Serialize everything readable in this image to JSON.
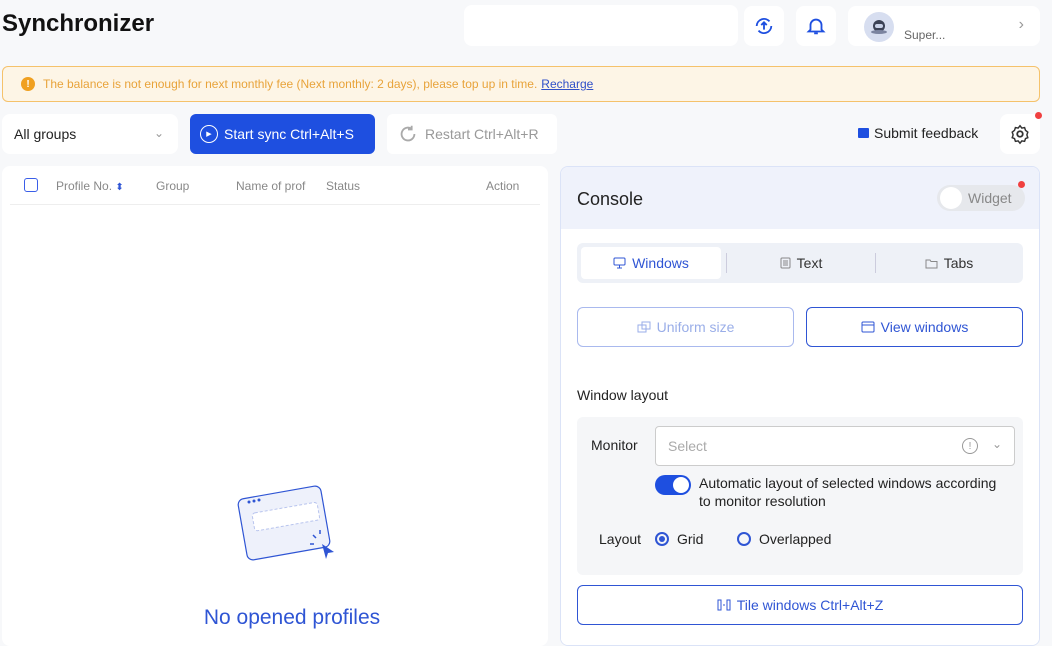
{
  "app": {
    "title": "Synchronizer"
  },
  "header": {
    "user_name": "Super..."
  },
  "banner": {
    "message": "The balance is not enough for next monthly fee (Next monthly: 2 days), please top up in time.",
    "link": "Recharge"
  },
  "toolbar": {
    "group_select": "All groups",
    "start_sync": "Start sync Ctrl+Alt+S",
    "restart": "Restart Ctrl+Alt+R",
    "feedback": "Submit feedback"
  },
  "table": {
    "columns": [
      "Profile No.",
      "Group",
      "Name of prof",
      "Status",
      "Action"
    ],
    "empty_text": "No opened profiles"
  },
  "console": {
    "title": "Console",
    "widget_label": "Widget",
    "tabs": [
      {
        "label": "Windows"
      },
      {
        "label": "Text"
      },
      {
        "label": "Tabs"
      }
    ],
    "uniform_size": "Uniform size",
    "view_windows": "View windows",
    "window_layout_label": "Window layout",
    "monitor_label": "Monitor",
    "monitor_placeholder": "Select",
    "auto_layout_text": "Automatic layout of selected windows according to monitor resolution",
    "layout_label": "Layout",
    "layout_options": [
      "Grid",
      "Overlapped"
    ],
    "tile_windows": "Tile windows Ctrl+Alt+Z"
  },
  "colors": {
    "accent": "#1e4fe0",
    "warning": "#f0a020",
    "notify_dot": "#f04040"
  }
}
